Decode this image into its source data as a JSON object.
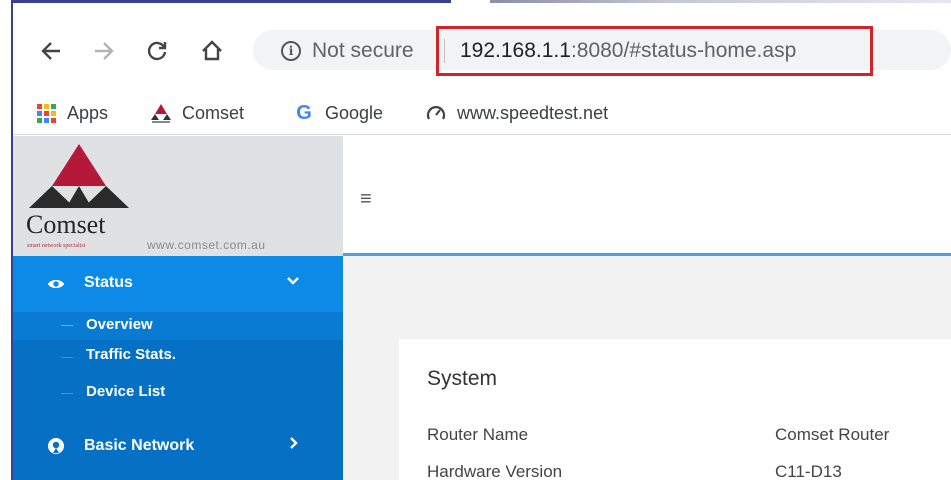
{
  "browser": {
    "security_label": "Not secure",
    "url_host": "192.168.1.1",
    "url_rest": ":8080/#status-home.asp",
    "bookmarks": [
      {
        "label": "Apps",
        "icon": "apps-grid-icon"
      },
      {
        "label": "Comset",
        "icon": "comset-logo-icon"
      },
      {
        "label": "Google",
        "icon": "google-icon"
      },
      {
        "label": "www.speedtest.net",
        "icon": "speedtest-icon"
      }
    ],
    "highlight_color": "#d2232a"
  },
  "logo": {
    "name": "Comset",
    "tagline": "smart network specialist",
    "website": "www.comset.com.au"
  },
  "sidebar": {
    "status_label": "Status",
    "items": [
      "Overview",
      "Traffic Stats.",
      "Device List"
    ],
    "basic_network_label": "Basic Network",
    "accent": "#0d8ae8"
  },
  "main": {
    "card_title": "System",
    "rows": [
      {
        "label": "Router Name",
        "value": "Comset Router"
      },
      {
        "label": "Hardware Version",
        "value": "C11-D13"
      }
    ]
  }
}
